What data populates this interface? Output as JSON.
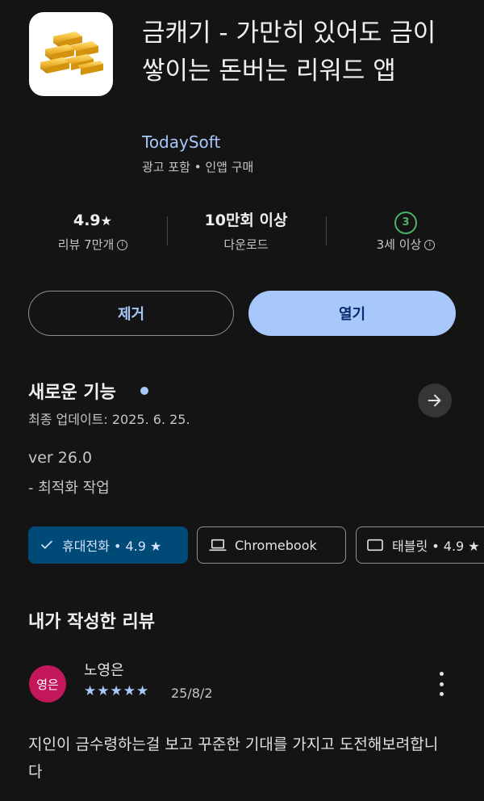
{
  "app": {
    "icon": "gold-bars-icon",
    "title": "금캐기 - 가만히 있어도 금이 쌓이는 돈버는 리워드 앱",
    "developer": "TodaySoft",
    "ads_line": "광고 포함 • 인앱 구매"
  },
  "stats": {
    "rating": "4.9",
    "rating_star": "★",
    "reviews_label": "리뷰 7만개",
    "downloads": "10만회 이상",
    "downloads_label": "다운로드",
    "age_badge": "3",
    "age_label": "3세 이상"
  },
  "buttons": {
    "remove": "제거",
    "open": "열기"
  },
  "whats_new": {
    "title": "새로운 기능",
    "updated": "최종 업데이트: 2025. 6. 25.",
    "version": "ver 26.0",
    "note": "- 최적화 작업"
  },
  "devices": {
    "phone": "휴대전화 • 4.9 ★",
    "chromebook": "Chromebook",
    "tablet": "태블릿 • 4.9 ★"
  },
  "my_review": {
    "title": "내가 작성한 리뷰",
    "avatar_text": "영은",
    "name": "노영은",
    "stars": "★★★★★",
    "rating": 5,
    "date": "25/8/2",
    "text": "지인이 금수령하는걸 보고 꾸준한 기대를 가지고 도전해보려합니다"
  },
  "colors": {
    "background": "#141414",
    "accent": "#a8c7fa",
    "selected_chip": "#004a77",
    "avatar": "#c2185b",
    "age_badge": "#4cb36a"
  }
}
